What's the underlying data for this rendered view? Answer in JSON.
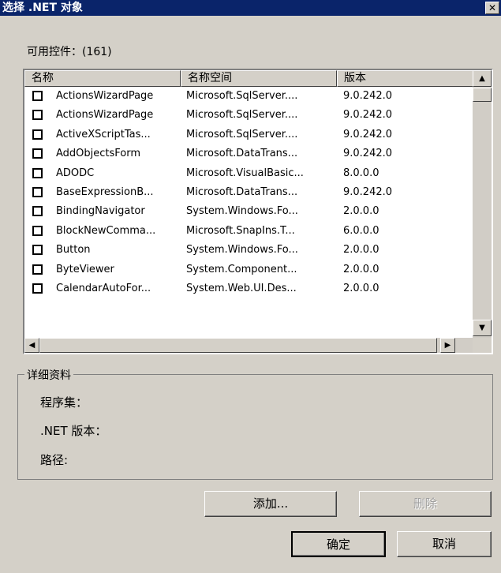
{
  "window": {
    "title": "选择 .NET 对象",
    "close_glyph": "✕"
  },
  "count_label": "可用控件：(161)",
  "list": {
    "columns": [
      "名称",
      "名称空间",
      "版本"
    ],
    "rows": [
      {
        "name": "ActionsWizardPage",
        "namespace": "Microsoft.SqlServer....",
        "version": "9.0.242.0",
        "checked": false
      },
      {
        "name": "ActionsWizardPage",
        "namespace": "Microsoft.SqlServer....",
        "version": "9.0.242.0",
        "checked": false
      },
      {
        "name": "ActiveXScriptTas...",
        "namespace": "Microsoft.SqlServer....",
        "version": "9.0.242.0",
        "checked": false
      },
      {
        "name": "AddObjectsForm",
        "namespace": "Microsoft.DataTrans...",
        "version": "9.0.242.0",
        "checked": false
      },
      {
        "name": "ADODC",
        "namespace": "Microsoft.VisualBasic...",
        "version": "8.0.0.0",
        "checked": false
      },
      {
        "name": "BaseExpressionB...",
        "namespace": "Microsoft.DataTrans...",
        "version": "9.0.242.0",
        "checked": false
      },
      {
        "name": "BindingNavigator",
        "namespace": "System.Windows.Fo...",
        "version": "2.0.0.0",
        "checked": false
      },
      {
        "name": "BlockNewComma...",
        "namespace": "Microsoft.SnapIns.T...",
        "version": "6.0.0.0",
        "checked": false
      },
      {
        "name": "Button",
        "namespace": "System.Windows.Fo...",
        "version": "2.0.0.0",
        "checked": false
      },
      {
        "name": "ByteViewer",
        "namespace": "System.Component...",
        "version": "2.0.0.0",
        "checked": false
      },
      {
        "name": "CalendarAutoFor...",
        "namespace": "System.Web.UI.Des...",
        "version": "2.0.0.0",
        "checked": false
      }
    ]
  },
  "details": {
    "group_label": "详细资料",
    "assembly_label": "程序集：",
    "net_version_label": ".NET 版本：",
    "path_label": "路径:"
  },
  "buttons": {
    "add": "添加...",
    "remove": "删除",
    "ok": "确定",
    "cancel": "取消"
  }
}
